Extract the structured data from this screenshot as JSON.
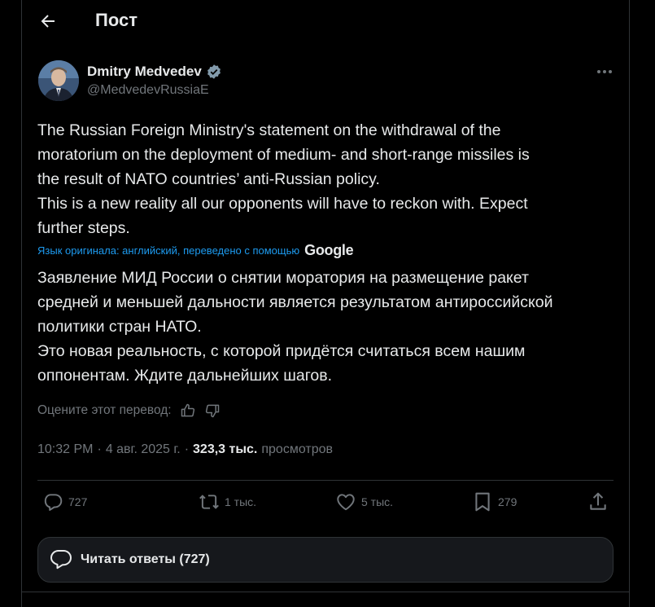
{
  "header": {
    "title": "Пост"
  },
  "author": {
    "name": "Dmitry Medvedev",
    "handle": "@MedvedevRussiaE"
  },
  "tweet": {
    "text": "The Russian Foreign Ministry's statement on the withdrawal of the\nmoratorium on the deployment of medium- and short-range missiles is\nthe result of NATO countries’ anti-Russian policy.\nThis is a new reality all our opponents will have to reckon with. Expect\nfurther steps.",
    "translation_note": "Язык оригинала: английский, переведено с помощью",
    "translation_brand": "Google",
    "translated_text": "Заявление МИД России о снятии моратория на размещение ракет\nсредней и меньшей дальности является результатом антироссийской\nполитики стран НАТО.\nЭто новая реальность, с которой придётся считаться всем нашим\nоппонентам. Ждите дальнейших шагов.",
    "rate_label": "Оцените этот перевод:"
  },
  "meta": {
    "time": "10:32 PM",
    "sep1": "·",
    "date": "4 авг. 2025 г.",
    "sep2": "·",
    "views": "323,3 тыс.",
    "views_label": "просмотров"
  },
  "actions": {
    "replies": "727",
    "reposts": "1 тыс.",
    "likes": "5 тыс.",
    "bookmarks": "279"
  },
  "read_replies": {
    "label": "Читать ответы (727)"
  },
  "colors": {
    "accent": "#1d9bf0",
    "background": "#000000",
    "muted": "#71767b",
    "border": "#2f3336"
  }
}
